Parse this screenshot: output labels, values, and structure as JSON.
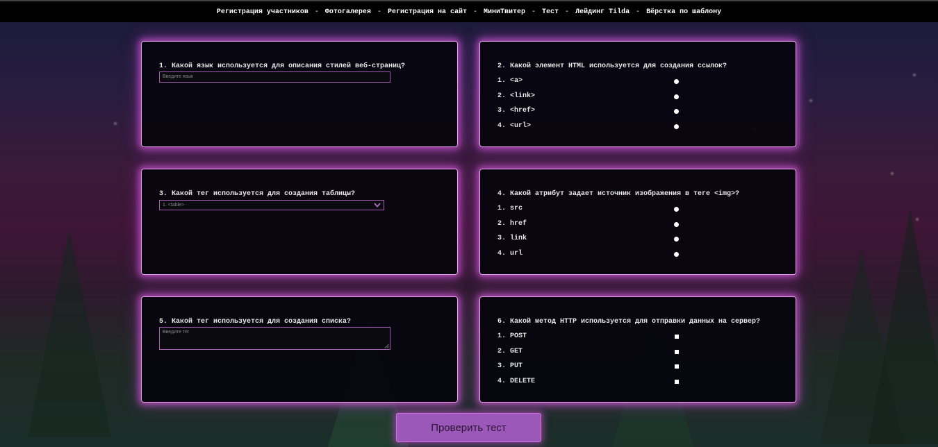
{
  "nav": {
    "items": [
      "Регистрация участников",
      "Фотогалерея",
      "Регистрация на сайт",
      "МиниТвитер",
      "Тест",
      "Лейдинг Tilda",
      "Вёрстка по шаблону"
    ],
    "separator": "-"
  },
  "questions": {
    "q1": {
      "title": "1. Какой язык используется для описания стилей веб-страниц?",
      "placeholder": "Введите язык"
    },
    "q2": {
      "title": "2. Какой элемент HTML используется для создания ссылок?",
      "options": [
        "1. <a>",
        "2. <link>",
        "3. <href>",
        "4. <url>"
      ]
    },
    "q3": {
      "title": "3. Какой тег используется для создания таблицы?",
      "selected": "1. <table>"
    },
    "q4": {
      "title": "4. Какой атрибут задает источник изображения в теге <img>?",
      "options": [
        "1. src",
        "2. href",
        "3. link",
        "4. url"
      ]
    },
    "q5": {
      "title": "5. Какой тег используется для создания списка?",
      "placeholder": "Введите тег"
    },
    "q6": {
      "title": "6. Какой метод HTTP используется для отправки данных на сервер?",
      "options": [
        "1. POST",
        "2. GET",
        "3. PUT",
        "4. DELETE"
      ]
    }
  },
  "submit_label": "Проверить тест",
  "colors": {
    "card_border": "#e9a3ea",
    "card_glow": "#d65adc",
    "button_bg": "#9b58b8",
    "input_border": "#a85cb5"
  },
  "icons": {
    "select": "chevron-down-icon",
    "textarea": "resize-handle-icon"
  }
}
